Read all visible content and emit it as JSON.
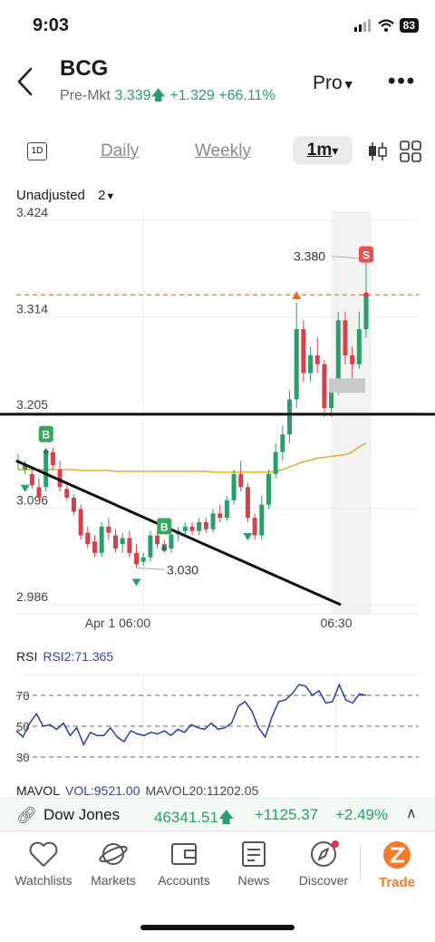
{
  "status": {
    "time": "9:03",
    "battery": "83"
  },
  "header": {
    "ticker": "BCG",
    "pre_label": "Pre-Mkt",
    "price": "3.339",
    "change": "+1.329",
    "pct": "+66.11%",
    "pro_label": "Pro",
    "more": "•••"
  },
  "timebar": {
    "icon": "1D",
    "tabs": [
      "Daily",
      "Weekly"
    ],
    "active": "1m",
    "active_caret": "▾"
  },
  "adjust": {
    "label": "Unadjusted",
    "value": "2"
  },
  "chart_data": {
    "type": "candlestick",
    "y_ticks": [
      "3.424",
      "3.314",
      "3.205",
      "3.096",
      "2.986"
    ],
    "x_ticks": [
      "Apr 1 06:00",
      "06:30"
    ],
    "ylim": [
      2.986,
      3.424
    ],
    "price_line": 3.339,
    "annotations": {
      "high": "3.380",
      "low": "3.030",
      "buy": "B",
      "sell": "S"
    },
    "candles": [
      [
        3.15,
        3.158,
        3.14,
        3.15
      ],
      [
        3.14,
        3.15,
        3.135,
        3.145
      ],
      [
        3.135,
        3.142,
        3.118,
        3.122
      ],
      [
        3.12,
        3.13,
        3.105,
        3.108
      ],
      [
        3.12,
        3.165,
        3.115,
        3.16
      ],
      [
        3.16,
        3.165,
        3.14,
        3.145
      ],
      [
        3.14,
        3.15,
        3.115,
        3.12
      ],
      [
        3.118,
        3.122,
        3.105,
        3.108
      ],
      [
        3.108,
        3.112,
        3.088,
        3.092
      ],
      [
        3.095,
        3.1,
        3.06,
        3.065
      ],
      [
        3.068,
        3.075,
        3.05,
        3.055
      ],
      [
        3.058,
        3.065,
        3.04,
        3.045
      ],
      [
        3.045,
        3.08,
        3.04,
        3.075
      ],
      [
        3.075,
        3.085,
        3.06,
        3.068
      ],
      [
        3.065,
        3.072,
        3.045,
        3.05
      ],
      [
        3.055,
        3.068,
        3.045,
        3.062
      ],
      [
        3.062,
        3.07,
        3.04,
        3.045
      ],
      [
        3.045,
        3.055,
        3.028,
        3.032
      ],
      [
        3.035,
        3.045,
        3.03,
        3.04
      ],
      [
        3.04,
        3.07,
        3.035,
        3.065
      ],
      [
        3.065,
        3.07,
        3.05,
        3.055
      ],
      [
        3.055,
        3.06,
        3.045,
        3.05
      ],
      [
        3.05,
        3.07,
        3.045,
        3.066
      ],
      [
        3.066,
        3.075,
        3.058,
        3.07
      ],
      [
        3.07,
        3.08,
        3.063,
        3.075
      ],
      [
        3.075,
        3.08,
        3.065,
        3.07
      ],
      [
        3.07,
        3.085,
        3.065,
        3.08
      ],
      [
        3.08,
        3.085,
        3.068,
        3.072
      ],
      [
        3.072,
        3.095,
        3.068,
        3.09
      ],
      [
        3.09,
        3.1,
        3.08,
        3.085
      ],
      [
        3.085,
        3.11,
        3.082,
        3.105
      ],
      [
        3.105,
        3.14,
        3.1,
        3.135
      ],
      [
        3.135,
        3.15,
        3.115,
        3.12
      ],
      [
        3.12,
        3.125,
        3.08,
        3.085
      ],
      [
        3.085,
        3.09,
        3.06,
        3.065
      ],
      [
        3.065,
        3.11,
        3.06,
        3.1
      ],
      [
        3.1,
        3.14,
        3.095,
        3.135
      ],
      [
        3.135,
        3.17,
        3.13,
        3.16
      ],
      [
        3.16,
        3.19,
        3.15,
        3.18
      ],
      [
        3.18,
        3.23,
        3.17,
        3.22
      ],
      [
        3.22,
        3.33,
        3.21,
        3.3
      ],
      [
        3.3,
        3.31,
        3.24,
        3.25
      ],
      [
        3.25,
        3.28,
        3.24,
        3.27
      ],
      [
        3.27,
        3.29,
        3.25,
        3.26
      ],
      [
        3.26,
        3.265,
        3.2,
        3.21
      ],
      [
        3.21,
        3.235,
        3.2,
        3.23
      ],
      [
        3.23,
        3.32,
        3.225,
        3.31
      ],
      [
        3.31,
        3.32,
        3.26,
        3.27
      ],
      [
        3.27,
        3.28,
        3.24,
        3.26
      ],
      [
        3.26,
        3.32,
        3.255,
        3.3
      ],
      [
        3.3,
        3.38,
        3.29,
        3.339
      ]
    ],
    "ma": [
      3.14,
      3.14,
      3.14,
      3.14,
      3.14,
      3.14,
      3.14,
      3.14,
      3.14,
      3.139,
      3.139,
      3.139,
      3.139,
      3.139,
      3.138,
      3.138,
      3.138,
      3.138,
      3.138,
      3.138,
      3.138,
      3.138,
      3.138,
      3.138,
      3.138,
      3.138,
      3.138,
      3.138,
      3.137,
      3.137,
      3.137,
      3.137,
      3.137,
      3.137,
      3.137,
      3.137,
      3.137,
      3.138,
      3.14,
      3.143,
      3.146,
      3.149,
      3.151,
      3.153,
      3.154,
      3.155,
      3.156,
      3.157,
      3.16,
      3.166,
      3.17
    ]
  },
  "rsi": {
    "label": "RSI",
    "value": "RSI2:71.365",
    "levels": [
      "70",
      "50",
      "30"
    ],
    "series": [
      47,
      43,
      52,
      58,
      50,
      51,
      48,
      52,
      44,
      49,
      38,
      46,
      44,
      44,
      49,
      43,
      40,
      47,
      45,
      44,
      46,
      45,
      47,
      44,
      48,
      46,
      51,
      49,
      48,
      52,
      48,
      49,
      52,
      63,
      66,
      60,
      49,
      43,
      56,
      66,
      67,
      71,
      77,
      76,
      70,
      73,
      65,
      66,
      77,
      67,
      65,
      71,
      70
    ]
  },
  "mavol": {
    "label": "MAVOL",
    "vol": "VOL:9521.00",
    "ma20": "MAVOL20:11202.05"
  },
  "ticker_strip": {
    "name": "Dow Jones",
    "value": "46341.51",
    "change": "+1125.37",
    "pct": "+2.49%",
    "caret": "∧"
  },
  "tabs": [
    {
      "label": "Watchlists"
    },
    {
      "label": "Markets"
    },
    {
      "label": "Accounts"
    },
    {
      "label": "News"
    },
    {
      "label": "Discover"
    },
    {
      "label": "Trade"
    }
  ],
  "colors": {
    "up": "#2a9d6a",
    "down": "#d3424a",
    "accent": "#f27a29",
    "ma": "#e6a623",
    "rsi": "#2a3ca8"
  }
}
